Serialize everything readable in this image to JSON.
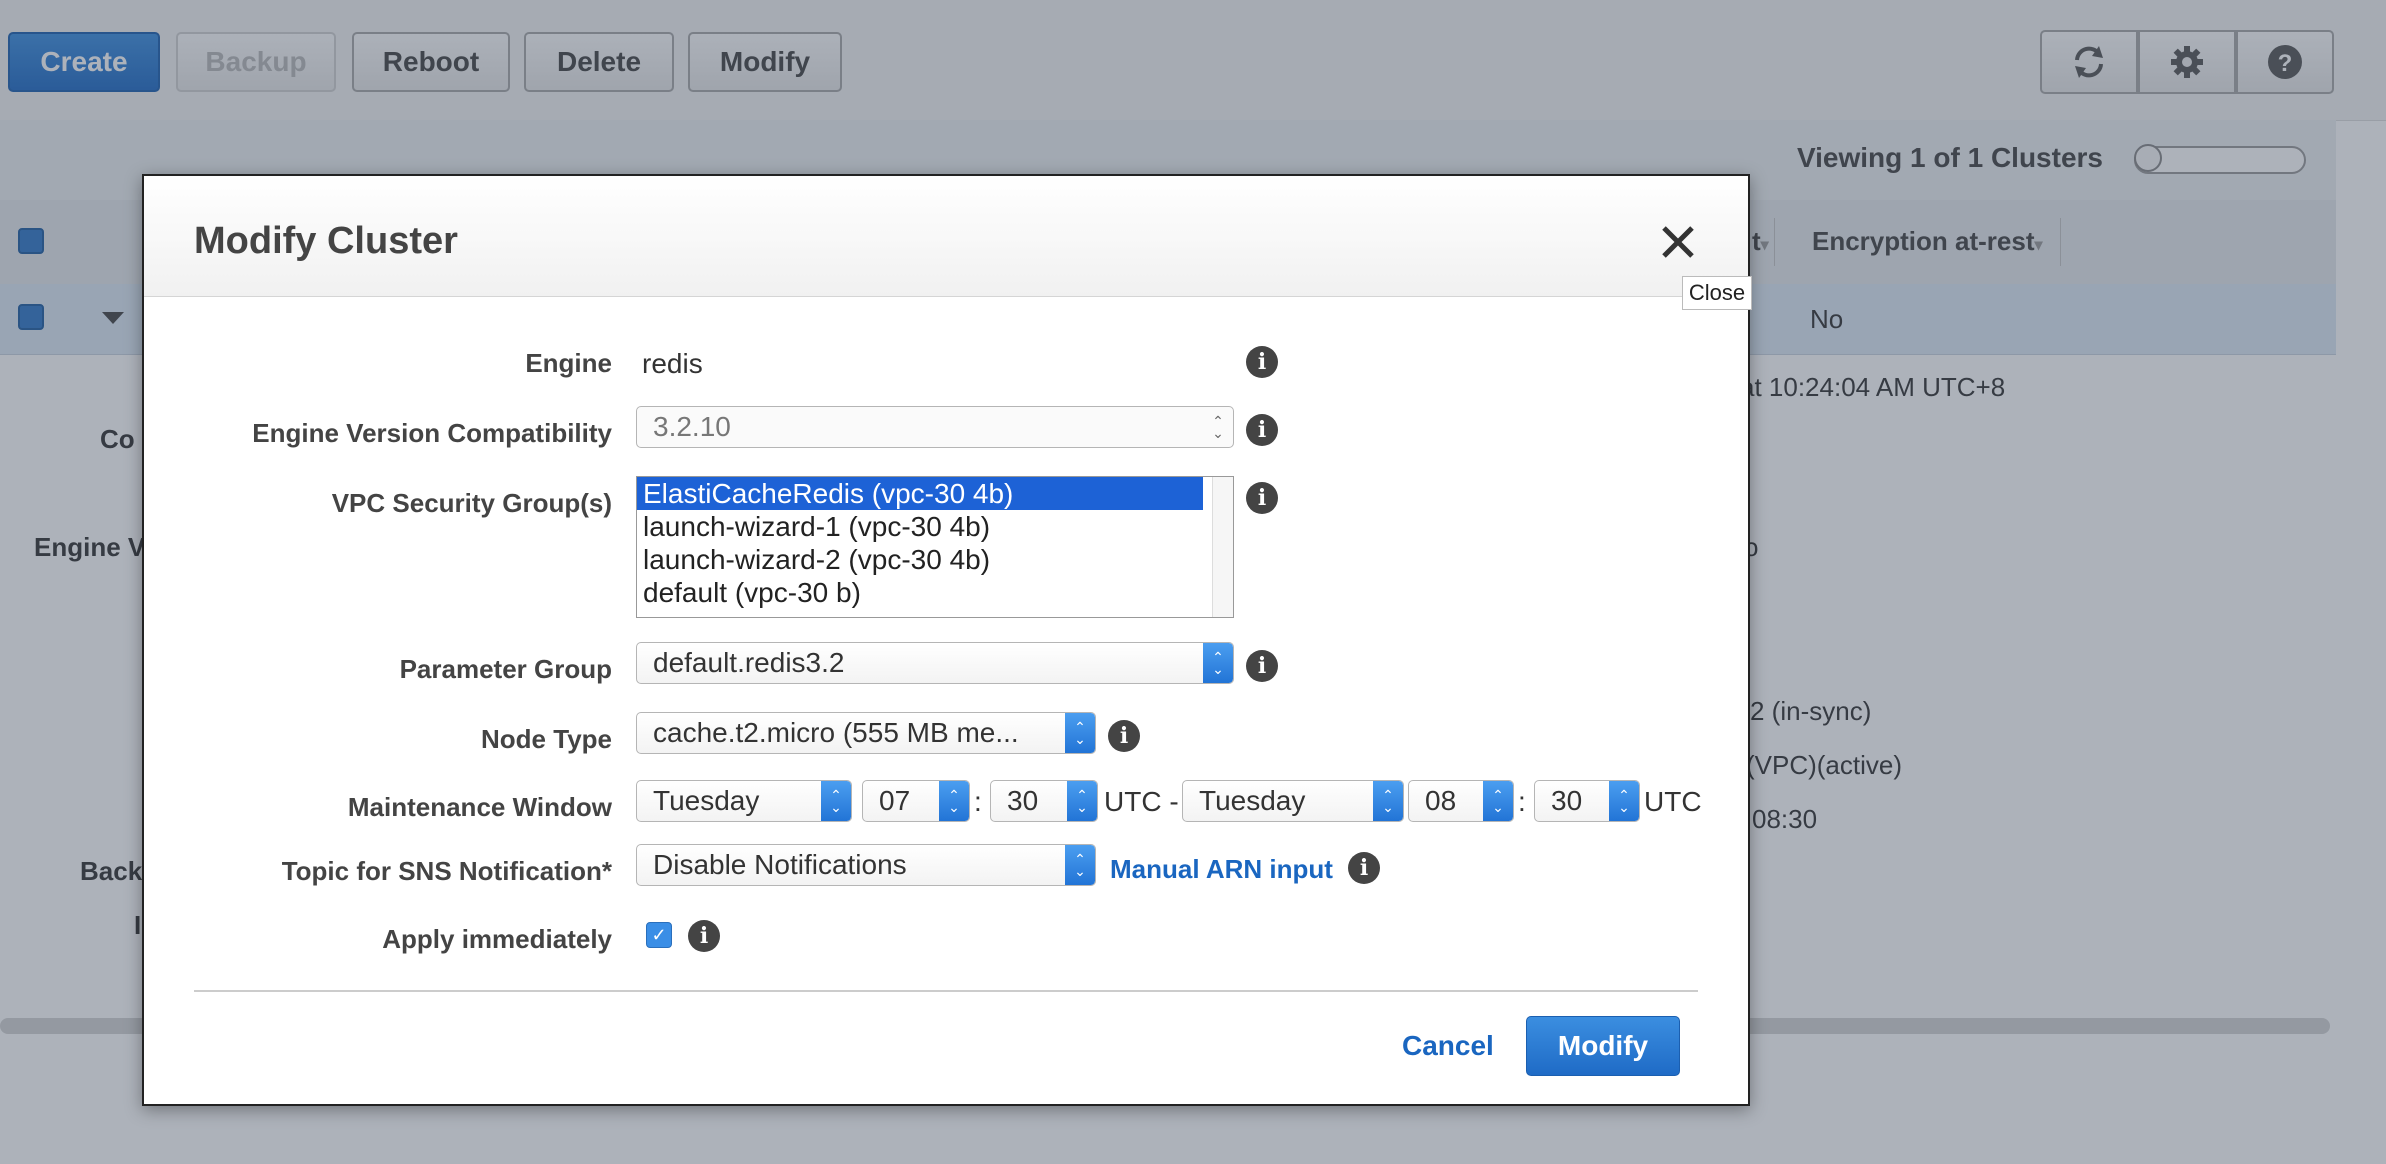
{
  "toolbar": {
    "buttons": [
      "Create",
      "Backup",
      "Reboot",
      "Delete",
      "Modify"
    ],
    "icons": [
      "refresh-icon",
      "gear-icon",
      "help-icon"
    ]
  },
  "list": {
    "viewing_text": "Viewing 1 of 1 Clusters",
    "header_partial": "t",
    "header_encryption": "Encryption at-rest",
    "row_encryption_value": "No"
  },
  "background": {
    "labels": [
      "Co",
      "Engine V",
      "Back",
      "I"
    ],
    "values": [
      "at 10:24:04 AM UTC+8",
      "o",
      "2 (in-sync)",
      "(VPC)(active)",
      "08:30"
    ]
  },
  "modal": {
    "title": "Modify Cluster",
    "close_tooltip": "Close",
    "engine": {
      "label": "Engine",
      "value": "redis"
    },
    "engine_version": {
      "label": "Engine Version Compatibility",
      "value": "3.2.10"
    },
    "security_groups": {
      "label": "VPC Security Group(s)",
      "options": [
        "ElastiCacheRedis (vpc-30      4b)",
        "launch-wizard-1 (vpc-30     4b)",
        "launch-wizard-2 (vpc-30      4b)",
        "default (vpc-30      b)"
      ],
      "selected_index": 0
    },
    "parameter_group": {
      "label": "Parameter Group",
      "value": "default.redis3.2"
    },
    "node_type": {
      "label": "Node Type",
      "value": "cache.t2.micro (555 MB me..."
    },
    "maintenance": {
      "label": "Maintenance Window",
      "start_day": "Tuesday",
      "start_hour": "07",
      "start_min": "30",
      "end_day": "Tuesday",
      "end_hour": "08",
      "end_min": "30",
      "utc_dash": "UTC -",
      "utc": "UTC",
      "colon": ":"
    },
    "sns": {
      "label": "Topic for SNS Notification*",
      "value": "Disable Notifications",
      "link": "Manual ARN input"
    },
    "apply_immediately": {
      "label": "Apply immediately",
      "checked": true
    },
    "cancel_label": "Cancel",
    "modify_label": "Modify"
  }
}
